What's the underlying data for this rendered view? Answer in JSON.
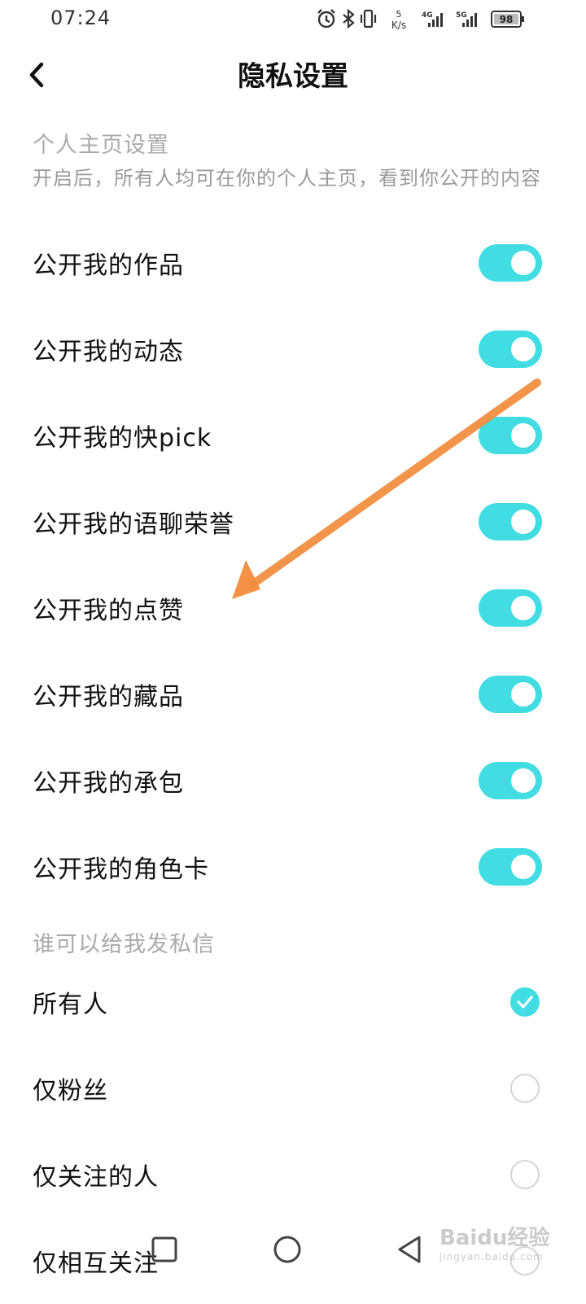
{
  "status_bar": {
    "time": "07:24",
    "net_speed_value": "5",
    "net_speed_unit": "K/s",
    "sim1_type": "4G",
    "sim2_type": "5G",
    "battery": "98",
    "icons": [
      "alarm-icon",
      "bluetooth-icon",
      "vibrate-icon",
      "signal-icon",
      "battery-icon"
    ]
  },
  "header": {
    "back_icon": "chevron-left-icon",
    "title": "隐私设置"
  },
  "profile_section": {
    "title": "个人主页设置",
    "description": "开启后，所有人均可在你的个人主页，看到你公开的内容",
    "toggles": [
      {
        "label": "公开我的作品",
        "on": true
      },
      {
        "label": "公开我的动态",
        "on": true
      },
      {
        "label": "公开我的快pick",
        "on": true
      },
      {
        "label": "公开我的语聊荣誉",
        "on": true
      },
      {
        "label": "公开我的点赞",
        "on": true
      },
      {
        "label": "公开我的藏品",
        "on": true
      },
      {
        "label": "公开我的承包",
        "on": true
      },
      {
        "label": "公开我的角色卡",
        "on": true
      }
    ]
  },
  "message_section": {
    "title": "谁可以给我发私信",
    "options": [
      {
        "label": "所有人",
        "selected": true
      },
      {
        "label": "仅粉丝",
        "selected": false
      },
      {
        "label": "仅关注的人",
        "selected": false
      },
      {
        "label": "仅相互关注",
        "selected": false
      }
    ]
  },
  "annotation": {
    "color": "#f28c3c",
    "icon": "annotation-arrow"
  },
  "watermark": {
    "brand": "Baidu经验",
    "url": "jingyan.baidu.com"
  },
  "colors": {
    "accent": "#41dde3",
    "section_title": "#aaaaaa",
    "text": "#111111"
  },
  "bottom_nav": {
    "icons": [
      "recent-apps-icon",
      "home-icon",
      "back-triangle-icon"
    ]
  }
}
